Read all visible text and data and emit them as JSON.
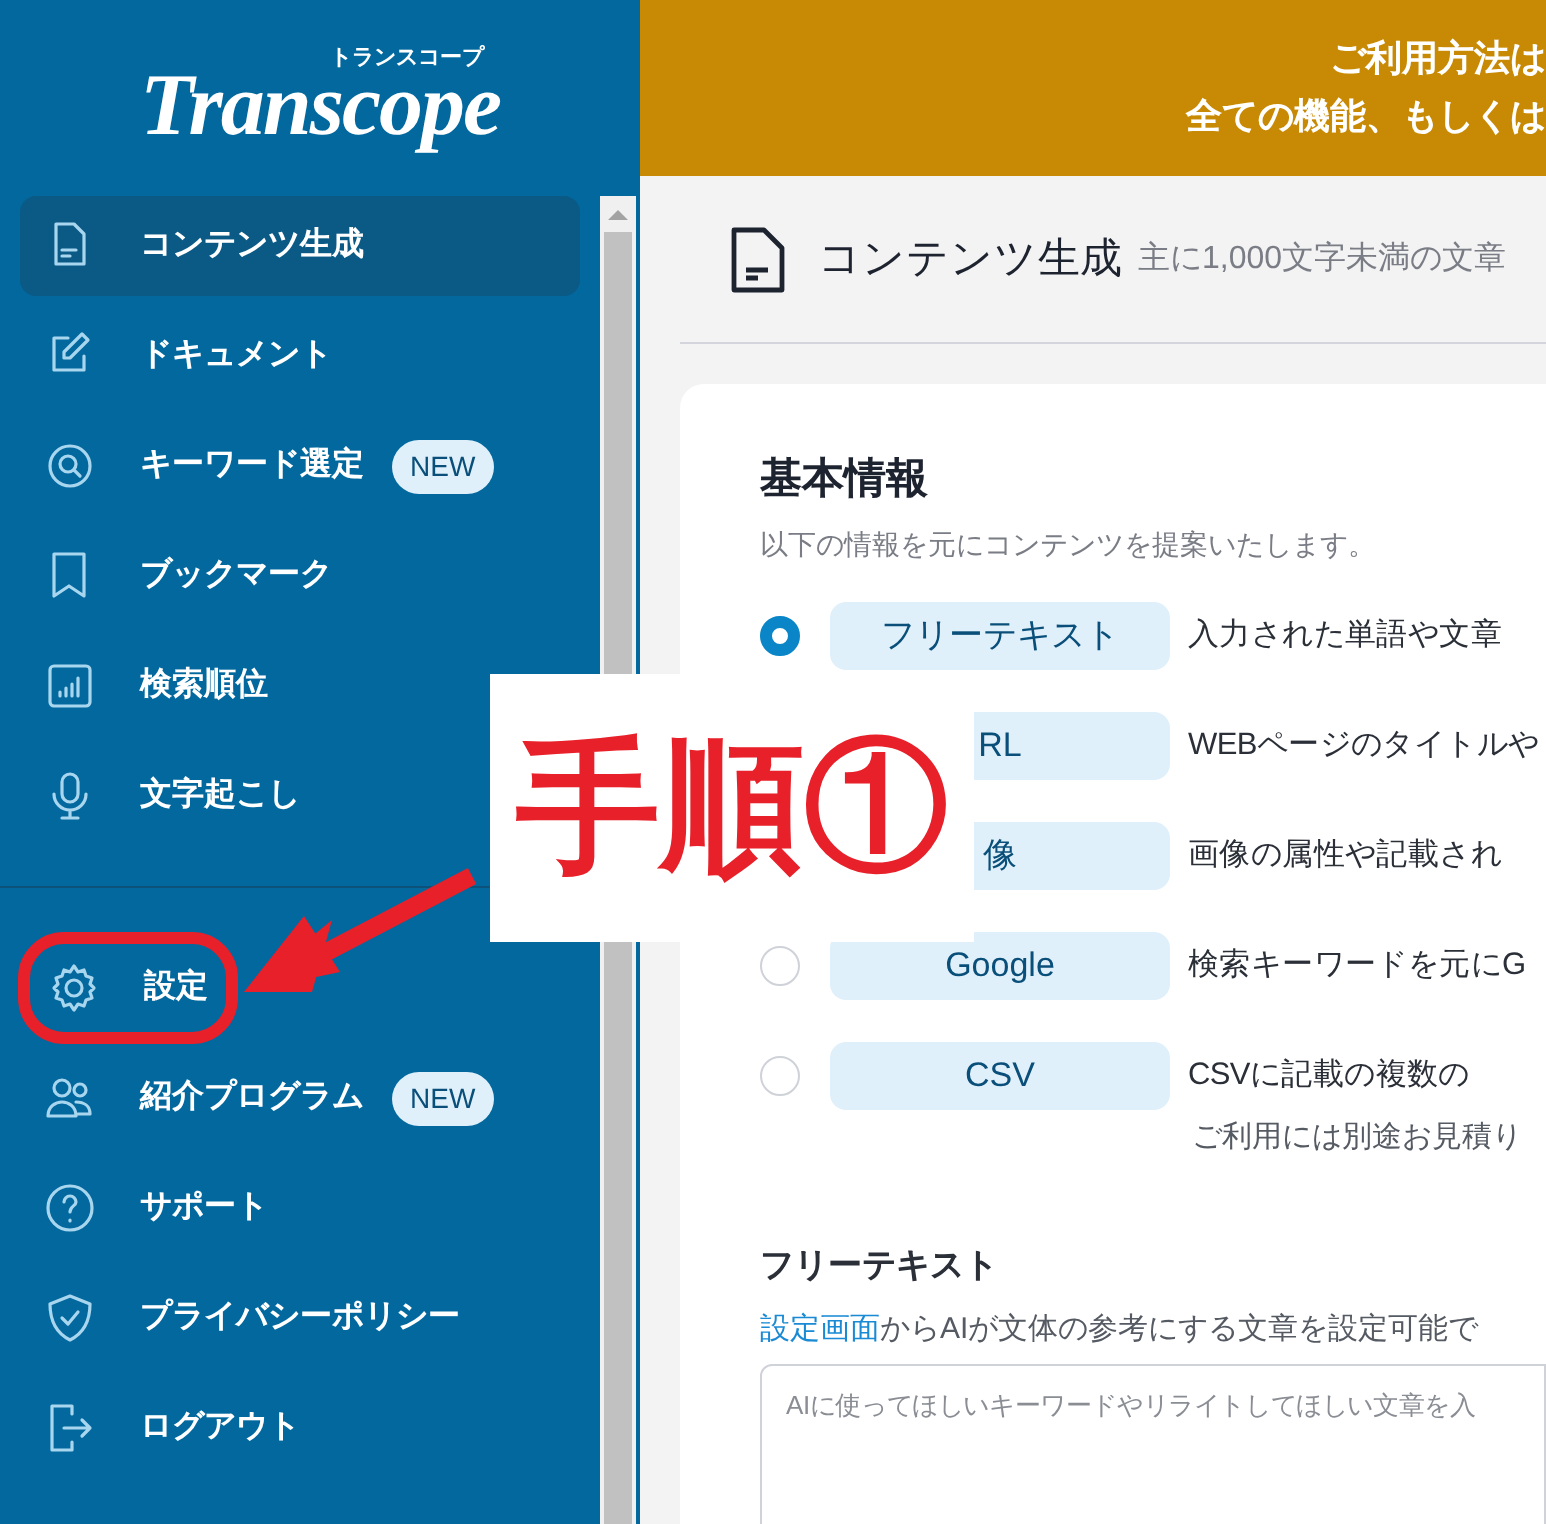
{
  "sidebar": {
    "logo": {
      "wordmark": "Transcope",
      "reading": "トランスコープ"
    },
    "groups": [
      [
        {
          "label": "コンテンツ生成",
          "selected": true
        },
        {
          "label": "ドキュメント",
          "selected": false
        },
        {
          "label": "キーワード選定",
          "badge": "NEW",
          "selected": false
        },
        {
          "label": "ブックマーク",
          "selected": false
        },
        {
          "label": "検索順位",
          "selected": false
        },
        {
          "label": "文字起こし",
          "selected": false
        }
      ],
      [
        {
          "label": "設定",
          "selected": false,
          "highlighted": true
        },
        {
          "label": "紹介プログラム",
          "badge": "NEW",
          "selected": false
        },
        {
          "label": "サポート",
          "selected": false
        },
        {
          "label": "プライバシーポリシー",
          "selected": false
        },
        {
          "label": "ログアウト",
          "selected": false
        }
      ]
    ]
  },
  "banner": {
    "lines": [
      "ご利用方法は",
      "全ての機能、もしくは"
    ]
  },
  "page_header": {
    "title": "コンテンツ生成",
    "subtitle": "主に1,000文字未満の文章"
  },
  "card": {
    "title": "基本情報",
    "subtitle": "以下の情報を元にコンテンツを提案いたします。",
    "options": [
      {
        "label": "フリーテキスト",
        "description": "入力された単語や文章",
        "selected": true
      },
      {
        "label": "RL",
        "description": "WEBページのタイトルや"
      },
      {
        "label": "像",
        "description": "画像の属性や記載され"
      },
      {
        "label": "Google",
        "description": "検索キーワードを元にG",
        "selected": false
      },
      {
        "label": "CSV",
        "description": "CSVに記載の複数の",
        "note": "ご利用には別途お見積り",
        "selected": false
      }
    ],
    "field": {
      "label": "フリーテキスト",
      "help_link": "設定画面",
      "help_text": "からAIが文体の参考にする文章を設定可能で",
      "placeholder": "AIに使ってほしいキーワードやリライトしてほしい文章を入"
    }
  },
  "annotation": {
    "step_label": "手順①"
  }
}
